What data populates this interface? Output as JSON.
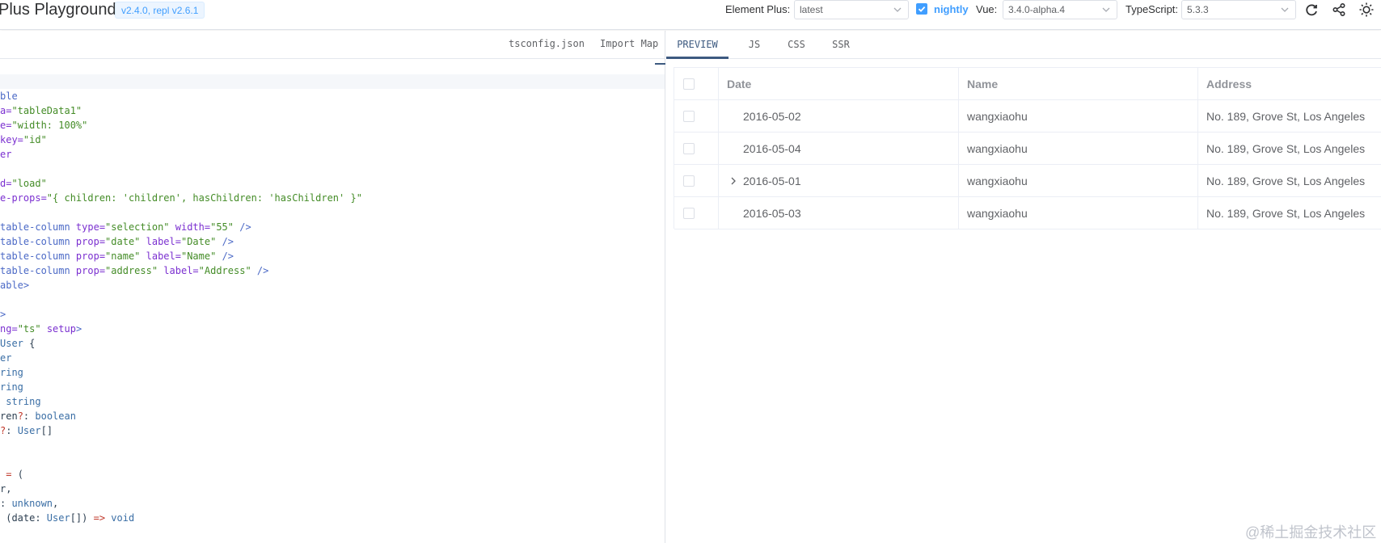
{
  "header": {
    "title": "Plus Playground",
    "version_badge": "v2.4.0, repl v2.6.1",
    "element_plus_label": "Element Plus:",
    "element_plus_value": "latest",
    "nightly_label": "nightly",
    "nightly_checked": true,
    "vue_label": "Vue:",
    "vue_value": "3.4.0-alpha.4",
    "typescript_label": "TypeScript:",
    "typescript_value": "5.3.3",
    "icons": [
      "refresh-icon",
      "share-icon",
      "sun-icon"
    ],
    "accent_color": "#409eff"
  },
  "editor": {
    "file_tabs": [
      "tsconfig.json",
      "Import Map"
    ],
    "code_lines": [
      [],
      [
        [
          "tag",
          "ble"
        ]
      ],
      [
        [
          "attr",
          "a="
        ],
        [
          "str",
          "\"tableData1\""
        ]
      ],
      [
        [
          "attr",
          "e="
        ],
        [
          "str",
          "\"width: 100%\""
        ]
      ],
      [
        [
          "attr",
          "key="
        ],
        [
          "str",
          "\"id\""
        ]
      ],
      [
        [
          "attr",
          "er"
        ]
      ],
      [],
      [
        [
          "attr",
          "d="
        ],
        [
          "str",
          "\"load\""
        ]
      ],
      [
        [
          "attr",
          "e-props="
        ],
        [
          "str",
          "\"{ children: 'children', hasChildren: 'hasChildren' }\""
        ]
      ],
      [],
      [
        [
          "tag",
          "table-column "
        ],
        [
          "attr",
          "type="
        ],
        [
          "str",
          "\"selection\""
        ],
        [
          "attr",
          " width="
        ],
        [
          "str",
          "\"55\""
        ],
        [
          "tag",
          " />"
        ]
      ],
      [
        [
          "tag",
          "table-column "
        ],
        [
          "attr",
          "prop="
        ],
        [
          "str",
          "\"date\""
        ],
        [
          "attr",
          " label="
        ],
        [
          "str",
          "\"Date\""
        ],
        [
          "tag",
          " />"
        ]
      ],
      [
        [
          "tag",
          "table-column "
        ],
        [
          "attr",
          "prop="
        ],
        [
          "str",
          "\"name\""
        ],
        [
          "attr",
          " label="
        ],
        [
          "str",
          "\"Name\""
        ],
        [
          "tag",
          " />"
        ]
      ],
      [
        [
          "tag",
          "table-column "
        ],
        [
          "attr",
          "prop="
        ],
        [
          "str",
          "\"address\""
        ],
        [
          "attr",
          " label="
        ],
        [
          "str",
          "\"Address\""
        ],
        [
          "tag",
          " />"
        ]
      ],
      [
        [
          "tag",
          "able>"
        ]
      ],
      [],
      [
        [
          "tag",
          ">"
        ]
      ],
      [
        [
          "attr",
          "ng="
        ],
        [
          "str",
          "\"ts\""
        ],
        [
          "attr",
          " setup"
        ],
        [
          "tag",
          ">"
        ]
      ],
      [
        [
          "type",
          "User"
        ],
        [
          "plain",
          " {"
        ]
      ],
      [
        [
          "type",
          "er"
        ]
      ],
      [
        [
          "type",
          "ring"
        ]
      ],
      [
        [
          "type",
          "ring"
        ]
      ],
      [
        [
          "plain",
          " "
        ],
        [
          "type",
          "string"
        ]
      ],
      [
        [
          "plain",
          "ren"
        ],
        [
          "op",
          "?"
        ],
        [
          "plain",
          ": "
        ],
        [
          "type",
          "boolean"
        ]
      ],
      [
        [
          "op",
          "?"
        ],
        [
          "plain",
          ": "
        ],
        [
          "type",
          "User"
        ],
        [
          "plain",
          "[]"
        ]
      ],
      [],
      [],
      [
        [
          "plain",
          " "
        ],
        [
          "op",
          "="
        ],
        [
          "plain",
          " ("
        ]
      ],
      [
        [
          "plain",
          "r,"
        ]
      ],
      [
        [
          "plain",
          ": "
        ],
        [
          "type",
          "unknown"
        ],
        [
          "plain",
          ","
        ]
      ],
      [
        [
          "plain",
          " (date: "
        ],
        [
          "type",
          "User"
        ],
        [
          "plain",
          "[]) "
        ],
        [
          "op",
          "=>"
        ],
        [
          "plain",
          " "
        ],
        [
          "type",
          "void"
        ]
      ]
    ]
  },
  "preview": {
    "tabs": [
      "PREVIEW",
      "JS",
      "CSS",
      "SSR"
    ],
    "active_tab": "PREVIEW",
    "columns": [
      "Date",
      "Name",
      "Address"
    ],
    "rows": [
      {
        "date": "2016-05-02",
        "name": "wangxiaohu",
        "address": "No. 189, Grove St, Los Angeles",
        "expandable": false
      },
      {
        "date": "2016-05-04",
        "name": "wangxiaohu",
        "address": "No. 189, Grove St, Los Angeles",
        "expandable": false
      },
      {
        "date": "2016-05-01",
        "name": "wangxiaohu",
        "address": "No. 189, Grove St, Los Angeles",
        "expandable": true
      },
      {
        "date": "2016-05-03",
        "name": "wangxiaohu",
        "address": "No. 189, Grove St, Los Angeles",
        "expandable": false
      }
    ]
  },
  "watermark": "@稀土掘金技术社区"
}
